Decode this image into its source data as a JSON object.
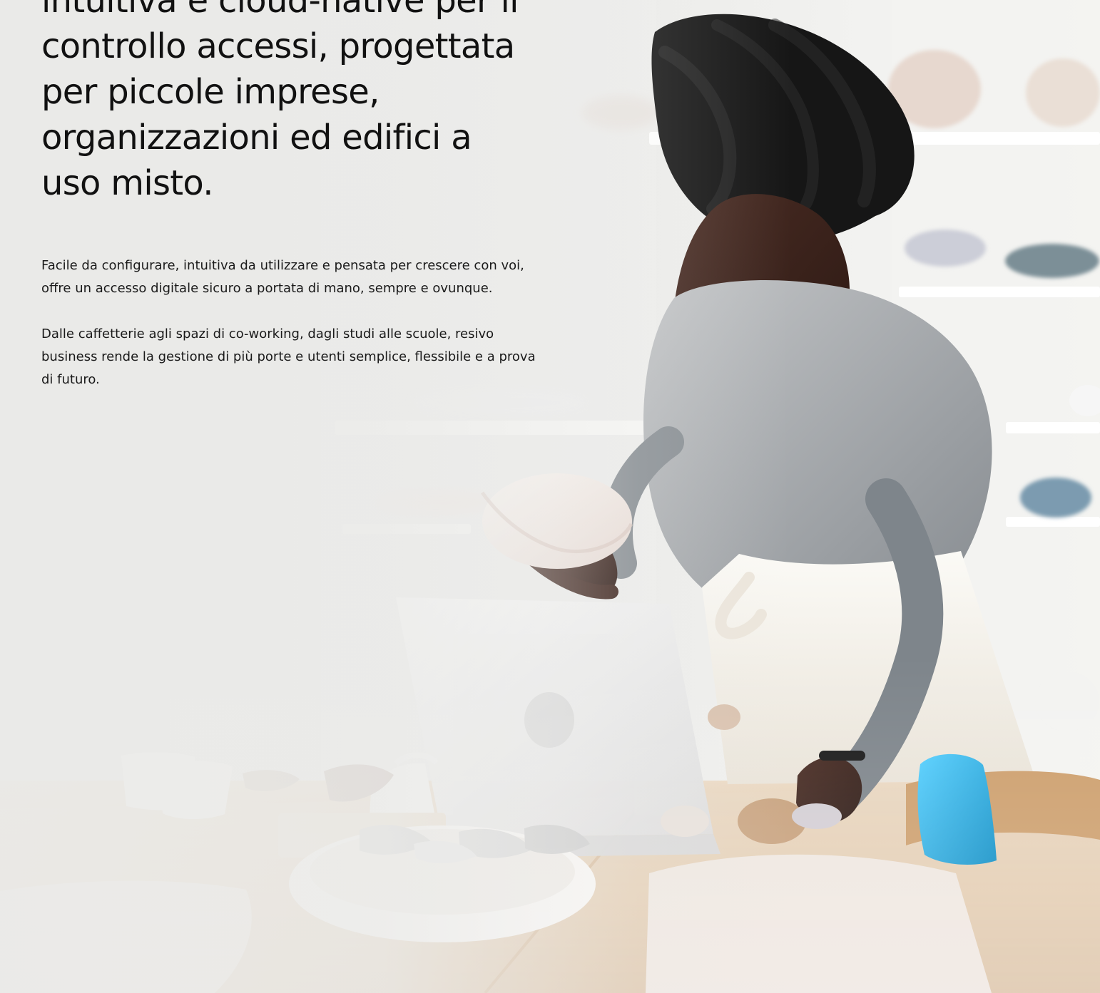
{
  "hero": {
    "headline_lines": [
      "intuitiva e cloud-native per il",
      "controllo accessi, progettata",
      "per piccole imprese,",
      "organizzazioni ed edifici a",
      "uso misto."
    ],
    "paragraphs": [
      "Facile da configurare, intuitiva da utilizzare e pensata per crescere con voi, offre un accesso digitale sicuro a portata di mano, sempre e ovunque.",
      "Dalle caffetterie agli spazi di co-working, dagli studi alle scuole, resivo business rende la gestione di più porte e utenti semplice, flessibile e a prova di futuro."
    ]
  },
  "colors": {
    "text": "#111111",
    "background": "#e7e6e4",
    "accent_blue": "#1aa4d8",
    "table_wood": "#d9b78d",
    "sweater_gray": "#8f9296",
    "apron_white": "#f5f2ec"
  }
}
